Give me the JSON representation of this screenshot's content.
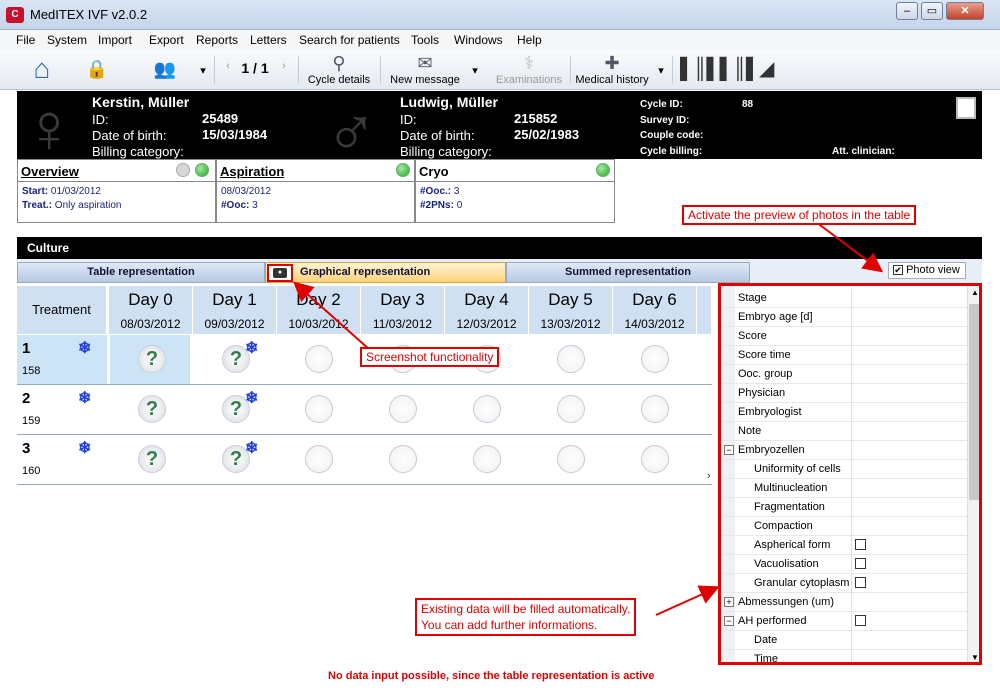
{
  "window": {
    "title": "MedITEX IVF v2.0.2",
    "logo": "C"
  },
  "menu": [
    "File",
    "System",
    "Import",
    "Export",
    "Reports",
    "Letters",
    "Search for patients",
    "Tools",
    "Windows",
    "Help"
  ],
  "toolbar": {
    "pager": "1 / 1",
    "cycle_details": "Cycle details",
    "new_message": "New message",
    "examinations": "Examinations",
    "medical_history": "Medical history"
  },
  "female": {
    "name": "Kerstin, Müller",
    "id_label": "ID:",
    "id": "25489",
    "dob_label": "Date of birth:",
    "dob": "15/03/1984",
    "billing_label": "Billing category:"
  },
  "male": {
    "name": "Ludwig, Müller",
    "id_label": "ID:",
    "id": "215852",
    "dob_label": "Date of birth:",
    "dob": "25/02/1983",
    "billing_label": "Billing category:"
  },
  "cycle": {
    "cycle_id_label": "Cycle ID:",
    "cycle_id": "88",
    "survey_label": "Survey ID:",
    "couple_label": "Couple code:",
    "billing_label": "Cycle billing:",
    "clinician_label": "Att. clinician:"
  },
  "overview": {
    "title": "Overview",
    "start_label": "Start:",
    "start": "01/03/2012",
    "treat_label": "Treat.:",
    "treat": "Only aspiration"
  },
  "aspiration": {
    "title": "Aspiration",
    "date": "08/03/2012",
    "ooc_label": "#Ooc:",
    "ooc": "3"
  },
  "cryo": {
    "title": "Cryo",
    "ooc_label": "#Ooc.:",
    "ooc": "3",
    "pn_label": "#2PNs:",
    "pn": "0"
  },
  "culture": {
    "title": "Culture"
  },
  "tabs": {
    "table": "Table representation",
    "graphical": "Graphical representation",
    "summed": "Summed representation",
    "photo_view": "Photo view"
  },
  "grid": {
    "treatment_header": "Treatment",
    "days": [
      {
        "day": "Day 0",
        "date": "08/03/2012"
      },
      {
        "day": "Day 1",
        "date": "09/03/2012"
      },
      {
        "day": "Day 2",
        "date": "10/03/2012"
      },
      {
        "day": "Day 3",
        "date": "11/03/2012"
      },
      {
        "day": "Day 4",
        "date": "12/03/2012"
      },
      {
        "day": "Day 5",
        "date": "13/03/2012"
      },
      {
        "day": "Day 6",
        "date": "14/03/2012"
      }
    ],
    "rows": [
      {
        "num": "1",
        "id": "158"
      },
      {
        "num": "2",
        "id": "159"
      },
      {
        "num": "3",
        "id": "160"
      }
    ]
  },
  "properties": [
    {
      "label": "Stage",
      "indent": 0
    },
    {
      "label": "Embryo age [d]",
      "indent": 0
    },
    {
      "label": "Score",
      "indent": 0
    },
    {
      "label": "Score time",
      "indent": 0
    },
    {
      "label": "Ooc. group",
      "indent": 0
    },
    {
      "label": "Physician",
      "indent": 0
    },
    {
      "label": "Embryologist",
      "indent": 0
    },
    {
      "label": "Note",
      "indent": 0
    },
    {
      "label": "Embryozellen",
      "indent": 0,
      "expander": "−"
    },
    {
      "label": "Uniformity of cells",
      "indent": 1
    },
    {
      "label": "Multinucleation",
      "indent": 1
    },
    {
      "label": "Fragmentation",
      "indent": 1
    },
    {
      "label": "Compaction",
      "indent": 1
    },
    {
      "label": "Aspherical form",
      "indent": 1,
      "checkbox": true
    },
    {
      "label": "Vacuolisation",
      "indent": 1,
      "checkbox": true
    },
    {
      "label": "Granular cytoplasm",
      "indent": 1,
      "checkbox": true
    },
    {
      "label": "Abmessungen (um)",
      "indent": 0,
      "expander": "+"
    },
    {
      "label": "AH performed",
      "indent": 0,
      "expander": "−",
      "checkbox": true
    },
    {
      "label": "Date",
      "indent": 1
    },
    {
      "label": "Time",
      "indent": 1
    }
  ],
  "callouts": {
    "photos": "Activate the preview of photos in the table",
    "screenshot": "Screenshot functionality",
    "existing": "Existing data will be filled automatically.\nYou can add further informations."
  },
  "footer_note": "No data input possible, since the table representation is active"
}
